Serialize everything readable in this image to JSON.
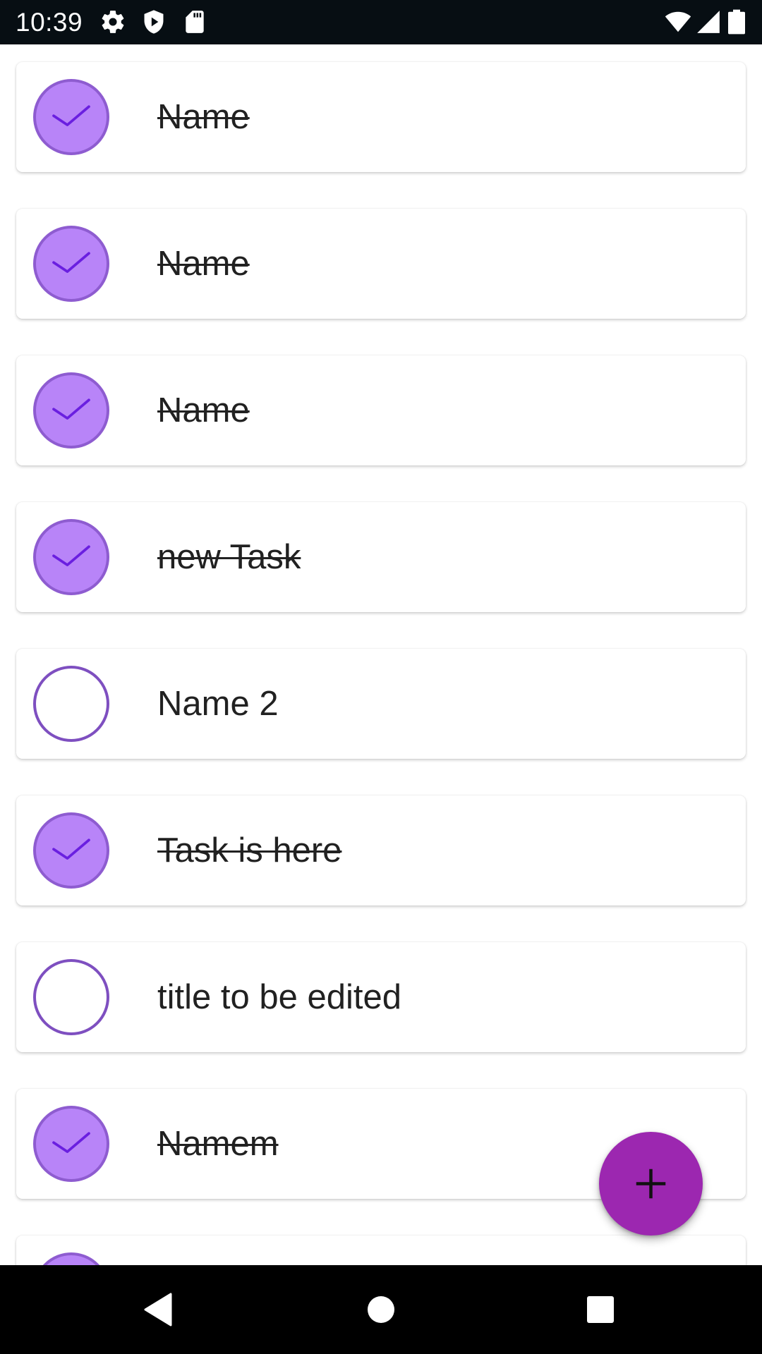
{
  "status_bar": {
    "time": "10:39",
    "left_icons": [
      "gear-icon",
      "shield-play-icon",
      "sd-card-icon"
    ],
    "right_icons": [
      "wifi-icon",
      "cell-signal-icon",
      "battery-icon"
    ]
  },
  "tasks": [
    {
      "title": "Name",
      "done": true
    },
    {
      "title": "Name",
      "done": true
    },
    {
      "title": "Name",
      "done": true
    },
    {
      "title": "new Task",
      "done": true
    },
    {
      "title": "Name 2",
      "done": false
    },
    {
      "title": "Task is here",
      "done": true
    },
    {
      "title": "title to be edited",
      "done": false
    },
    {
      "title": "Namem",
      "done": true
    },
    {
      "title": "",
      "done": true
    }
  ],
  "fab": {
    "icon": "plus-icon"
  },
  "nav_bar": {
    "buttons": [
      "back-icon",
      "home-icon",
      "recents-icon"
    ]
  },
  "colors": {
    "status_bar": "#070e13",
    "checked_fill": "#b884f8",
    "check_mark": "#6a1fe0",
    "unchecked_border": "#7e4fc0",
    "fab": "#9c27b0",
    "text": "#212121"
  }
}
